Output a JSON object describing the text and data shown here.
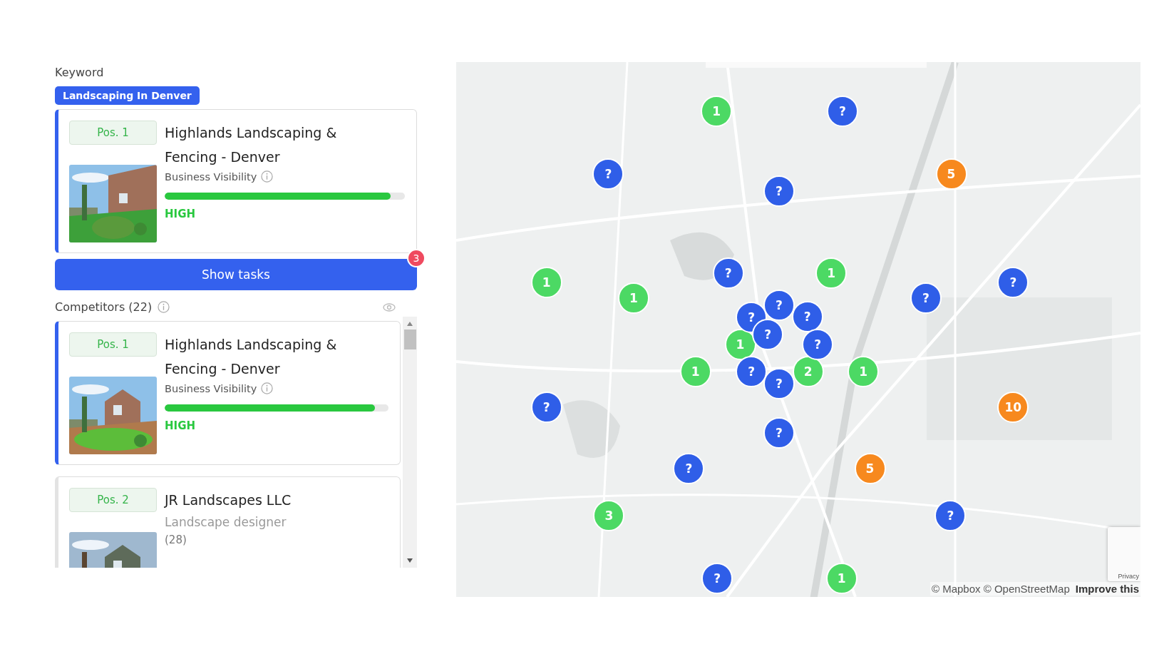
{
  "keyword": {
    "label": "Keyword",
    "chip": "Landscaping In Denver"
  },
  "main_card": {
    "position": "Pos. 1",
    "name": "Highlands Landscaping & Fencing - Denver",
    "kind": "visibility",
    "visibility_label": "Business Visibility",
    "level": 0.94,
    "rating": "HIGH",
    "highlighted": true
  },
  "show_tasks": {
    "label": "Show tasks",
    "badge": "3"
  },
  "competitors": {
    "title": "Competitors (22)",
    "cards": [
      {
        "position": "Pos. 1",
        "name": "Highlands Landscaping & Fencing - Denver",
        "kind": "visibility",
        "visibility_label": "Business Visibility",
        "level": 0.94,
        "rating": "HIGH",
        "highlighted": true
      },
      {
        "position": "Pos. 2",
        "name": "JR Landscapes LLC",
        "kind": "category",
        "category": "Landscape designer",
        "reviews": "(28)",
        "highlighted": false
      }
    ]
  },
  "map": {
    "pins": [
      {
        "label": "1",
        "color": "#4cd964"
      },
      {
        "label": "?",
        "color": "#2f5ee8"
      },
      {
        "label": "?",
        "color": "#2f5ee8"
      },
      {
        "label": "5",
        "color": "#f7891e"
      },
      {
        "label": "?",
        "color": "#2f5ee8"
      },
      {
        "label": "?",
        "color": "#2f5ee8"
      },
      {
        "label": "1",
        "color": "#4cd964"
      },
      {
        "label": "1",
        "color": "#4cd964"
      },
      {
        "label": "?",
        "color": "#2f5ee8"
      },
      {
        "label": "1",
        "color": "#4cd964"
      },
      {
        "label": "?",
        "color": "#2f5ee8"
      },
      {
        "label": "?",
        "color": "#2f5ee8"
      },
      {
        "label": "?",
        "color": "#2f5ee8"
      },
      {
        "label": "?",
        "color": "#2f5ee8"
      },
      {
        "label": "?",
        "color": "#2f5ee8"
      },
      {
        "label": "1",
        "color": "#4cd964"
      },
      {
        "label": "?",
        "color": "#2f5ee8"
      },
      {
        "label": "1",
        "color": "#4cd964"
      },
      {
        "label": "?",
        "color": "#2f5ee8"
      },
      {
        "label": "2",
        "color": "#4cd964"
      },
      {
        "label": "1",
        "color": "#4cd964"
      },
      {
        "label": "?",
        "color": "#2f5ee8"
      },
      {
        "label": "?",
        "color": "#2f5ee8"
      },
      {
        "label": "10",
        "color": "#f7891e"
      },
      {
        "label": "?",
        "color": "#2f5ee8"
      },
      {
        "label": "?",
        "color": "#2f5ee8"
      },
      {
        "label": "5",
        "color": "#f7891e"
      },
      {
        "label": "3",
        "color": "#4cd964"
      },
      {
        "label": "?",
        "color": "#2f5ee8"
      },
      {
        "label": "?",
        "color": "#2f5ee8"
      },
      {
        "label": "1",
        "color": "#4cd964"
      }
    ],
    "attribution": "© Mapbox © OpenStreetMap",
    "improve_link": "Improve this",
    "privacy": "Privacy"
  }
}
